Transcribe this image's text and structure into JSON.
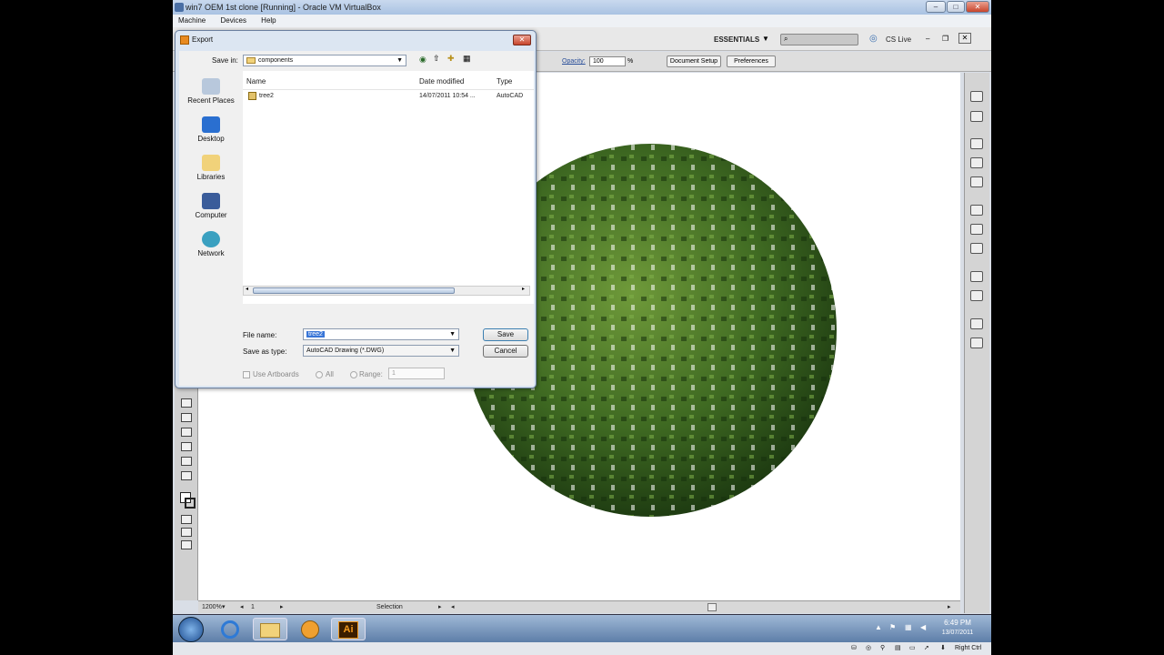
{
  "host": {
    "title": "win7 OEM 1st clone [Running] - Oracle VM VirtualBox",
    "menu": [
      "Machine",
      "Devices",
      "Help"
    ],
    "status_right": "Right Ctrl"
  },
  "illustrator": {
    "workspace": "ESSENTIALS",
    "cslive": "CS Live",
    "opacity_label": "Opacity:",
    "opacity_value": "100",
    "opacity_unit": "%",
    "doc_setup": "Document Setup",
    "preferences": "Preferences",
    "zoom": "1200%",
    "page": "1",
    "status_tool": "Selection"
  },
  "dialog": {
    "title": "Export",
    "save_in_label": "Save in:",
    "save_in_value": "components",
    "places": [
      "Recent Places",
      "Desktop",
      "Libraries",
      "Computer",
      "Network"
    ],
    "columns": {
      "name": "Name",
      "date": "Date modified",
      "type": "Type"
    },
    "files": [
      {
        "name": "tree2",
        "date": "14/07/2011 10:54 ...",
        "type": "AutoCAD"
      }
    ],
    "file_name_label": "File name:",
    "file_name_value": "tree2",
    "save_as_type_label": "Save as type:",
    "save_as_type_value": "AutoCAD Drawing (*.DWG)",
    "save_label": "Save",
    "cancel_label": "Cancel",
    "use_artboards": "Use Artboards",
    "all": "All",
    "range": "Range:",
    "range_value": "1"
  },
  "tray": {
    "time": "6:49 PM",
    "date": "13/07/2011"
  },
  "taskbar_ai": "Ai"
}
